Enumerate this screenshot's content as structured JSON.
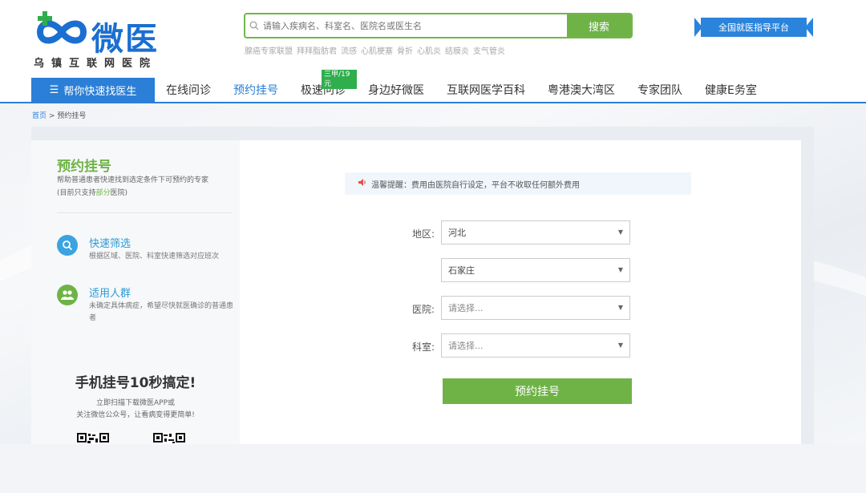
{
  "header": {
    "brand": "微医",
    "brand_sub": "乌镇互联网医院",
    "search": {
      "placeholder": "请输入疾病名、科室名、医院名或医生名",
      "button_label": "搜索",
      "hot_terms": [
        "腺癌专家联盟",
        "拜拜脂肪君",
        "流感",
        "心肌梗塞",
        "骨折",
        "心肌炎",
        "结膜炎",
        "支气管炎"
      ]
    },
    "platform_label": "全国就医指导平台"
  },
  "nav": {
    "main_label": "帮你快速找医生",
    "items": [
      {
        "label": "在线问诊"
      },
      {
        "label": "预约挂号"
      },
      {
        "label": "极速问诊",
        "badge": "三甲/19元"
      },
      {
        "label": "身边好微医"
      },
      {
        "label": "互联网医学百科"
      },
      {
        "label": "粤港澳大湾区"
      },
      {
        "label": "专家团队"
      },
      {
        "label": "健康E务室"
      }
    ]
  },
  "breadcrumb": {
    "home": "首页",
    "sep": ">",
    "current": "预约挂号"
  },
  "sidebar": {
    "title": "预约挂号",
    "desc_1": "帮助普通患者快速找到选定条件下可预约的专家",
    "desc_2_pre": "(目前只支持",
    "desc_2_hl": "部分",
    "desc_2_post": "医院)",
    "features": [
      {
        "title": "快速筛选",
        "desc": "根据区域、医院、科室快速筛选对应班次"
      },
      {
        "title": "适用人群",
        "desc": "未确定具体病症，希望尽快就医确诊的普通患者"
      }
    ],
    "promo_title": "手机挂号10秒搞定!",
    "promo_line1": "立即扫描下载微医APP或",
    "promo_line2": "关注微信公众号，让看病变得更简单!"
  },
  "form": {
    "notice": "温馨提醒：费用由医院自行设定，平台不收取任何额外费用",
    "region_label": "地区:",
    "province": "河北",
    "city": "石家庄",
    "hospital_label": "医院:",
    "hospital_placeholder": "请选择...",
    "dept_label": "科室:",
    "dept_placeholder": "请选择...",
    "submit_label": "预约挂号"
  },
  "colors": {
    "brand_blue": "#2b7fd7",
    "brand_green": "#6fb347",
    "accent_cyan": "#2b9bd6"
  }
}
